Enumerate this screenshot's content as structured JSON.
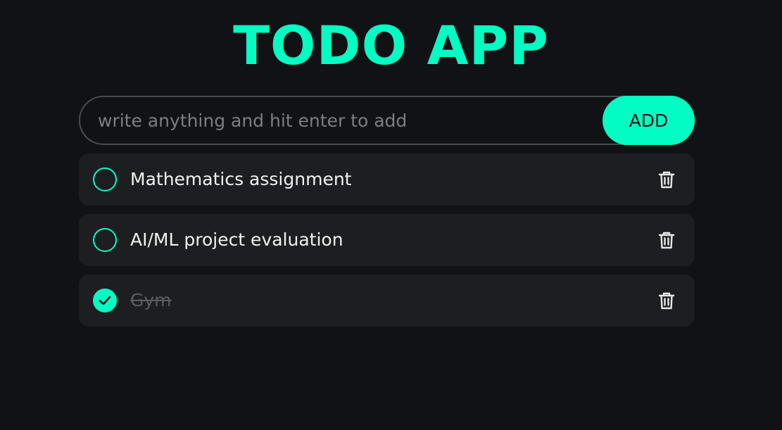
{
  "app": {
    "title": "TODO APP"
  },
  "input": {
    "placeholder": "write anything and hit enter to add",
    "value": "",
    "add_label": "ADD"
  },
  "todos": [
    {
      "text": "Mathematics assignment",
      "completed": false
    },
    {
      "text": "AI/ML project evaluation",
      "completed": false
    },
    {
      "text": "Gym",
      "completed": true
    }
  ],
  "icons": {
    "checkbox": "circle-icon",
    "checked": "check-circle-icon",
    "delete": "trash-icon"
  },
  "colors": {
    "background": "#111216",
    "accent": "#03fcc2",
    "card": "#1d1e22",
    "text": "#f2f2f2",
    "muted": "#5a5c62"
  }
}
